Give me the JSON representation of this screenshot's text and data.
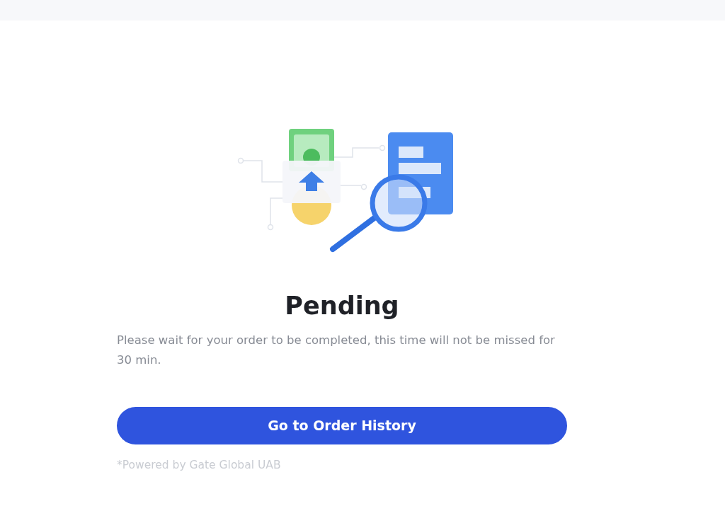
{
  "status": {
    "title": "Pending",
    "message": "Please wait for your order to be completed, this time will not be missed for 30 min."
  },
  "button": {
    "label": "Go to Order History"
  },
  "footnote": "*Powered by Gate Global UAB"
}
